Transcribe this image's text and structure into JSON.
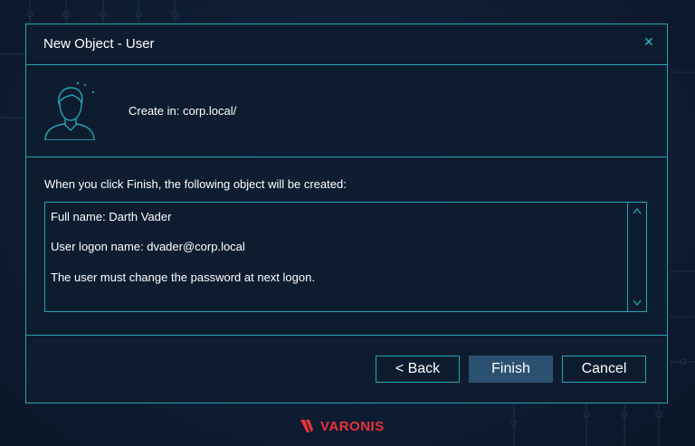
{
  "window": {
    "title": "New Object - User",
    "close_icon": "close-icon"
  },
  "header": {
    "create_in": "Create in: corp.local/"
  },
  "summary": {
    "intro": "When you click Finish, the following object will be created:",
    "lines": [
      "Full name: Darth Vader",
      "User logon name: dvader@corp.local",
      "The user must change the password at next logon."
    ]
  },
  "buttons": {
    "back": "< Back",
    "finish": "Finish",
    "cancel": "Cancel"
  },
  "branding": {
    "logo_text": "VARONIS"
  },
  "colors": {
    "accent": "#21a6b4",
    "background": "#0f1d33",
    "finish_button": "#2c5170",
    "brand_red": "#e8343c"
  }
}
